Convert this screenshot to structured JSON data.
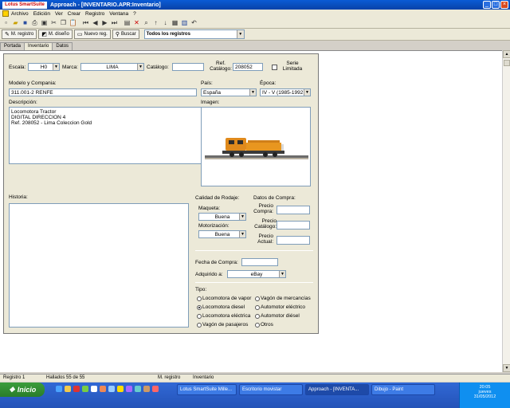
{
  "window": {
    "logo": "Lotus SmartSuite",
    "title": "Approach - [INVENTARIO.APR:Inventario]",
    "controls": [
      "_",
      "□",
      "×"
    ]
  },
  "menu": [
    "Archivo",
    "Edición",
    "Ver",
    "Crear",
    "Registro",
    "Ventana",
    "?"
  ],
  "actionbar": {
    "m_registro": "M. registro",
    "m_diseno": "M. diseño",
    "nuevo_reg": "Nuevo reg.",
    "buscar": "Buscar",
    "find_select": "Todos los registros"
  },
  "tabs": [
    "Portada",
    "Inventario",
    "Datos"
  ],
  "form": {
    "escala_label": "Escala:",
    "escala_value": "H0",
    "marca_label": "Marca:",
    "marca_value": "LIMA",
    "catalogo_label": "Catálogo:",
    "catalogo_value": "",
    "ref_label": "Ref. Catálogo:",
    "ref_value": "208052",
    "serie_label": "Serie Limitada",
    "modelo_label": "Modelo y Compania:",
    "modelo_value": "311.001-2 RENFE",
    "pais_label": "País:",
    "pais_value": "España",
    "epoca_label": "Época:",
    "epoca_value": "IV - V (1985-1992",
    "descripcion_label": "Descripción:",
    "descripcion_lines": [
      "Locomotora Tractor",
      "DIGITAL DIRECCION 4",
      "Ref. 208052 - Lima Coleccion Gold"
    ],
    "imagen_label": "Imagen:",
    "historia_label": "Historia:",
    "calidad_label": "Calidad de Rodaje:",
    "maqueta_label": "Maqueta:",
    "maqueta_value": "Buena",
    "motorizacion_label": "Motorización:",
    "motorizacion_value": "Buena",
    "datos_compra_label": "Datos de Compra:",
    "precio_compra_label": "Precio Compra:",
    "precio_catalogo_label": "Precio Catálogo:",
    "precio_actual_label": "Precio Actual:",
    "fecha_label": "Fecha de Compra:",
    "adquirido_label": "Adquirido a:",
    "adquirido_value": "eBay",
    "tipo_label": "Tipo:",
    "tipos": [
      {
        "label": "Locomotora de vapor",
        "checked": false
      },
      {
        "label": "Locomotora diesel",
        "checked": true
      },
      {
        "label": "Locomotora eléctrica",
        "checked": false
      },
      {
        "label": "Vagón de pasajeros",
        "checked": false
      },
      {
        "label": "Vagón de mercancías",
        "checked": false
      },
      {
        "label": "Automotor eléctrico",
        "checked": false
      },
      {
        "label": "Automotor diésel",
        "checked": false
      },
      {
        "label": "Otros",
        "checked": false
      }
    ]
  },
  "status": {
    "registro": "Registro 1",
    "hallados": "Hallados 55 de 55",
    "modo": "M. registro",
    "form": "Inventario"
  },
  "taskbar": {
    "start": "Inicio",
    "tasks": [
      "Lotus SmartSuite Mille...",
      "Escritorio movistar",
      "Approach - [INVENTA...",
      "Dibujo - Paint"
    ],
    "time": "20:05",
    "day": "jueves",
    "date": "31/05/2012"
  }
}
